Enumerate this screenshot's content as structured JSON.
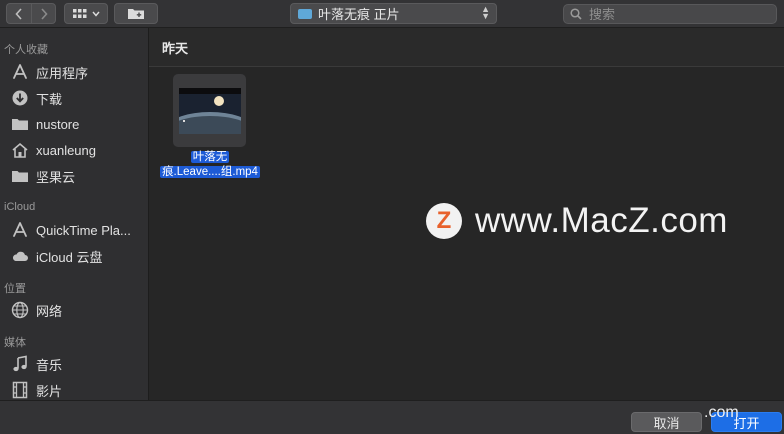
{
  "toolbar": {
    "path_label": "叶落无痕 正片",
    "search_placeholder": "搜索"
  },
  "sidebar": {
    "favorites_title": "个人收藏",
    "favorites": [
      {
        "label": "应用程序",
        "icon": "applications-icon"
      },
      {
        "label": "下载",
        "icon": "download-icon"
      },
      {
        "label": "nustore",
        "icon": "folder-icon"
      },
      {
        "label": "xuanleung",
        "icon": "home-icon"
      },
      {
        "label": "坚果云",
        "icon": "folder-icon"
      }
    ],
    "icloud_title": "iCloud",
    "icloud": [
      {
        "label": "QuickTime Pla...",
        "icon": "applications-icon"
      },
      {
        "label": "iCloud 云盘",
        "icon": "cloud-icon"
      }
    ],
    "locations_title": "位置",
    "locations": [
      {
        "label": "网络",
        "icon": "network-icon"
      }
    ],
    "media_title": "媒体",
    "media": [
      {
        "label": "音乐",
        "icon": "music-icon"
      },
      {
        "label": "影片",
        "icon": "film-icon"
      }
    ]
  },
  "main": {
    "date_header": "昨天",
    "file": {
      "name_line1": "叶落无",
      "name_line2": "痕.Leave....组.mp4"
    }
  },
  "watermark": {
    "logo_letter": "Z",
    "text": "www.MacZ.com",
    "footer_text": ".com"
  },
  "footer": {
    "cancel_label": "取消",
    "open_label": "打开"
  },
  "colors": {
    "accent": "#1d6ee6",
    "selection": "#1d5bd6",
    "logo_orange": "#e8612c"
  }
}
